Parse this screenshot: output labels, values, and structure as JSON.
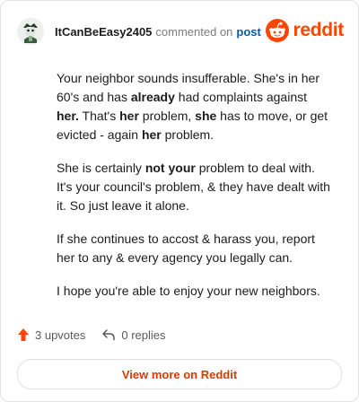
{
  "comment": {
    "author": "ItCanBeEasy2405",
    "action_text": "commented on",
    "post_link_text": "post",
    "paragraphs": [
      [
        {
          "t": "Your neighbor sounds insufferable. She's in her 60's and has "
        },
        {
          "t": "already",
          "b": true
        },
        {
          "t": " had complaints against "
        },
        {
          "t": "her.",
          "b": true
        },
        {
          "t": " That's "
        },
        {
          "t": "her",
          "b": true
        },
        {
          "t": " problem, "
        },
        {
          "t": "she",
          "b": true
        },
        {
          "t": " has to move, or get evicted - again "
        },
        {
          "t": "her",
          "b": true
        },
        {
          "t": " problem."
        }
      ],
      [
        {
          "t": "She is certainly "
        },
        {
          "t": "not your",
          "b": true
        },
        {
          "t": " problem to deal with. It's your council's problem, & they have dealt with it. So just leave it alone."
        }
      ],
      [
        {
          "t": "If she continues to accost & harass you, report her to any & every agency you legally can."
        }
      ],
      [
        {
          "t": "I hope you're able to enjoy your new neighbors."
        }
      ]
    ]
  },
  "brand": {
    "name": "reddit",
    "color": "#ff4500"
  },
  "stats": {
    "upvotes": "3 upvotes",
    "replies": "0 replies",
    "upvote_color": "#ff4500"
  },
  "cta": {
    "label": "View more on Reddit",
    "color": "#d93a00"
  }
}
